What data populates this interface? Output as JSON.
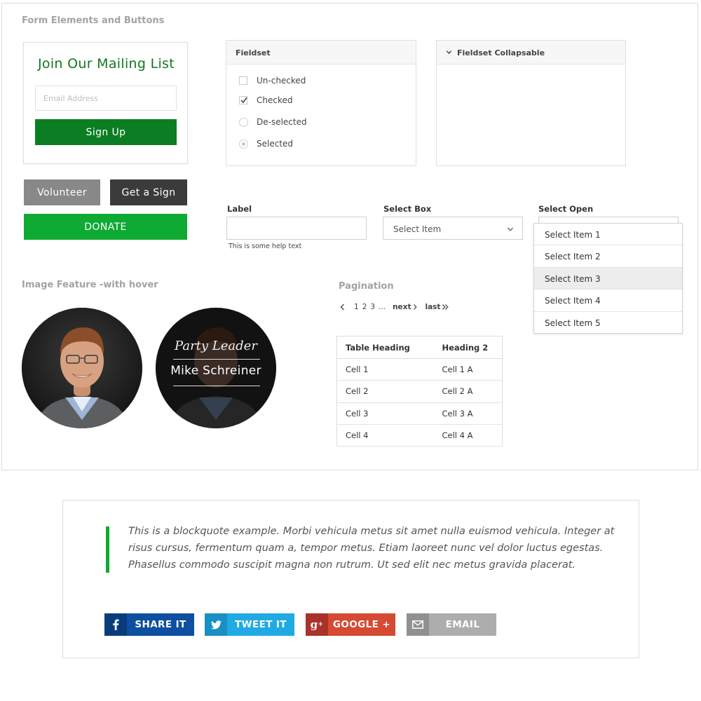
{
  "form_section": {
    "title": "Form Elements and Buttons",
    "mailing": {
      "title": "Join Our Mailing List",
      "email_placeholder": "Email Address",
      "signup_label": "Sign Up"
    },
    "buttons": {
      "volunteer": "Volunteer",
      "get_sign": "Get a Sign",
      "donate": "DONATE"
    },
    "fieldset": {
      "title": "Fieldset",
      "options": [
        {
          "label": "Un-checked",
          "type": "checkbox",
          "state": "unchecked"
        },
        {
          "label": "Checked",
          "type": "checkbox",
          "state": "checked"
        },
        {
          "label": "De-selected",
          "type": "radio",
          "state": "deselected"
        },
        {
          "label": "Selected",
          "type": "radio",
          "state": "selected"
        }
      ]
    },
    "fieldset_collapsable": {
      "title": "Fieldset Collapsable"
    },
    "label_field": {
      "label": "Label",
      "help": "This is some help text"
    },
    "select_box": {
      "label": "Select Box",
      "placeholder": "Select Item"
    },
    "select_open": {
      "label": "Select Open",
      "items": [
        "Select Item 1",
        "Select Item 2",
        "Select Item 3",
        "Select Item 4",
        "Select Item 5"
      ],
      "highlighted_index": 2
    }
  },
  "image_feature": {
    "title": "Image Feature -with hover",
    "overlay_title": "Party Leader",
    "overlay_name": "Mike Schreiner"
  },
  "pagination": {
    "title": "Pagination",
    "prev_icon": "chevron-left-icon",
    "pages": [
      "1",
      "2",
      "3",
      "..."
    ],
    "next": "next",
    "last": "last"
  },
  "table": {
    "headers": [
      "Table Heading",
      "Heading 2"
    ],
    "rows": [
      [
        "Cell 1",
        "Cell 1 A"
      ],
      [
        "Cell 2",
        "Cell 2 A"
      ],
      [
        "Cell 3",
        "Cell 3 A"
      ],
      [
        "Cell 4",
        "Cell 4 A"
      ]
    ]
  },
  "quote": {
    "text": "This is a blockquote example. Morbi vehicula metus sit amet nulla euismod vehicula. Integer at risus cursus, fermentum quam a, tempor metus. Etiam laoreet nunc vel dolor luctus egestas. Phasellus commodo suscipit magna non rutrum. Ut sed elit nec metus gravida placerat."
  },
  "share": {
    "facebook": {
      "label": "SHARE IT",
      "icon": "facebook-icon",
      "color": "#0e4fa0"
    },
    "twitter": {
      "label": "TWEET IT",
      "icon": "twitter-icon",
      "color": "#1faae3"
    },
    "google": {
      "label": "GOOGLE +",
      "icon": "google-plus-icon",
      "color": "#d64933"
    },
    "email": {
      "label": "EMAIL",
      "icon": "envelope-icon",
      "color": "#adadad"
    }
  },
  "colors": {
    "brand_green": "#0b7e23",
    "donate_green": "#0eaa32",
    "title_green": "#11781f"
  }
}
